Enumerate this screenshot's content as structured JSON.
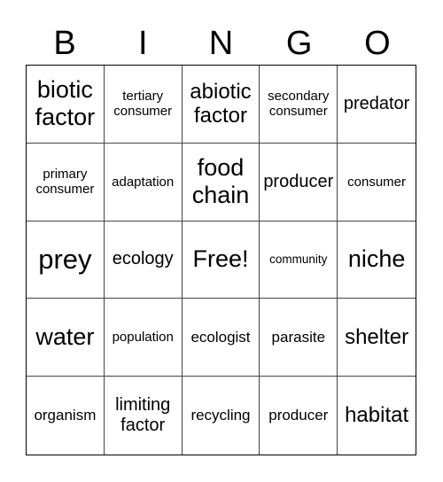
{
  "header": {
    "letters": [
      "B",
      "I",
      "N",
      "G",
      "O"
    ]
  },
  "board": {
    "rows": [
      [
        "biotic factor",
        "tertiary consumer",
        "abiotic factor",
        "secondary consumer",
        "predator"
      ],
      [
        "primary consumer",
        "adaptation",
        "food chain",
        "producer",
        "consumer"
      ],
      [
        "prey",
        "ecology",
        "Free!",
        "community",
        "niche"
      ],
      [
        "water",
        "population",
        "ecologist",
        "parasite",
        "shelter"
      ],
      [
        "organism",
        "limiting factor",
        "recycling",
        "producer",
        "habitat"
      ]
    ]
  }
}
